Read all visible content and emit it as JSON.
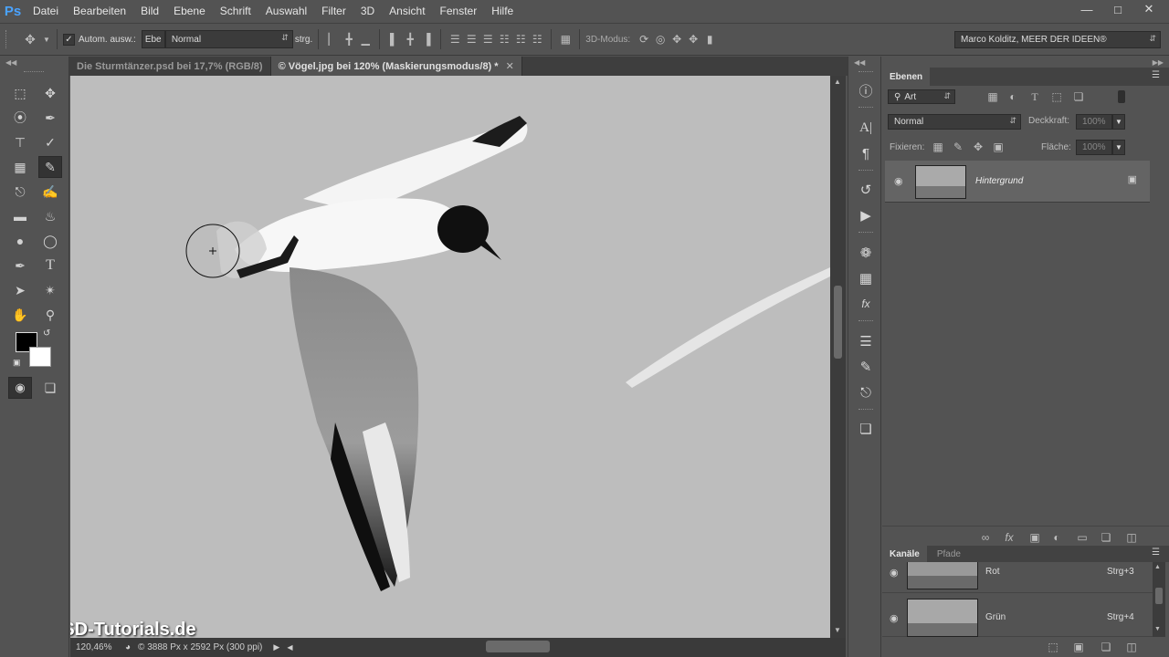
{
  "app": {
    "logo": "Ps"
  },
  "menu": {
    "items": [
      "Datei",
      "Bearbeiten",
      "Bild",
      "Ebene",
      "Schrift",
      "Auswahl",
      "Filter",
      "3D",
      "Ansicht",
      "Fenster",
      "Hilfe"
    ]
  },
  "options": {
    "auto_select_label": "Autom. ausw.:",
    "layer_select_value": "Ebe",
    "blend_value": "Normal",
    "transform_label": "strg.",
    "mode3d_label": "3D-Modus:",
    "workspace_value": "Marco Kolditz, MEER DER IDEEN®"
  },
  "tabs": [
    {
      "label": "Die Sturmtänzer.psd bei 17,7% (RGB/8)",
      "active": false
    },
    {
      "label": "© Vögel.jpg bei 120% (Maskierungsmodus/8) *",
      "active": true
    }
  ],
  "status": {
    "zoom": "120,46%",
    "info": "© 3888 Px x 2592 Px (300 ppi)"
  },
  "watermark": "PSD-Tutorials.de",
  "layers_panel": {
    "tab": "Ebenen",
    "filter_label": "Art",
    "blend_value": "Normal",
    "opacity_label": "Deckkraft:",
    "opacity_value": "100%",
    "lock_label": "Fixieren:",
    "fill_label": "Fläche:",
    "fill_value": "100%",
    "layers": [
      {
        "name": "Hintergrund",
        "locked": true
      }
    ]
  },
  "channels_panel": {
    "tabs": [
      "Kanäle",
      "Pfade"
    ],
    "channels": [
      {
        "name": "Rot",
        "shortcut": "Strg+3"
      },
      {
        "name": "Grün",
        "shortcut": "Strg+4"
      }
    ]
  },
  "colors": {
    "foreground": "#000000",
    "background": "#ffffff",
    "accent": "#4aa3ff",
    "canvas_gray": "#bcbcbc"
  },
  "icons": [
    "move-tool-icon",
    "marquee-icon",
    "lasso-icon",
    "quick-select-icon",
    "crop-icon",
    "eyedropper-icon",
    "healing-icon",
    "brush-icon",
    "stamp-icon",
    "history-brush-icon",
    "eraser-icon",
    "bucket-icon",
    "blur-icon",
    "dodge-icon",
    "pen-icon",
    "type-icon",
    "path-select-icon",
    "shape-icon",
    "hand-icon",
    "zoom-icon",
    "quick-mask-icon",
    "screen-mode-icon"
  ]
}
